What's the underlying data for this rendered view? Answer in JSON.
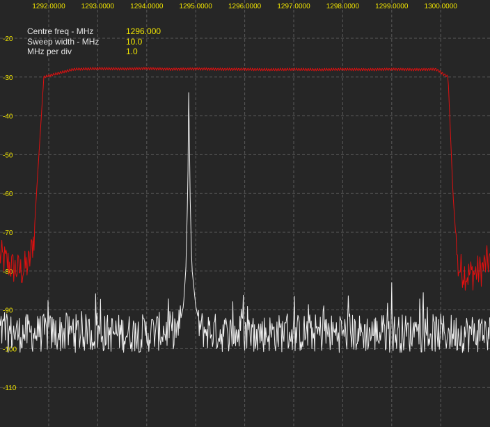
{
  "info": {
    "centre_label": "Centre freq - MHz",
    "centre_value": "1296.000",
    "sweep_label": "Sweep width - MHz",
    "sweep_value": "10.0",
    "mhz_div_label": "MHz per div",
    "mhz_div_value": "1.0"
  },
  "colors": {
    "background": "#262626",
    "grid": "#5a5a5a",
    "x_tick_text": "#f2e600",
    "y_tick_text": "#f2e600",
    "trace_red": "#e01010",
    "trace_white": "#f0f0f0"
  },
  "chart_data": {
    "type": "line",
    "title": "",
    "xlabel": "",
    "ylabel": "",
    "x_unit": "MHz",
    "y_unit": "dB",
    "grid": true,
    "xlim": [
      1291.0,
      1301.0
    ],
    "ylim": [
      -120,
      -18
    ],
    "x_ticks": [
      "1292.0000",
      "1293.0000",
      "1294.0000",
      "1295.0000",
      "1296.0000",
      "1297.0000",
      "1298.0000",
      "1299.0000",
      "1300.0000"
    ],
    "y_ticks": [
      "-20",
      "-30",
      "-40",
      "-50",
      "-60",
      "-70",
      "-80",
      "-90",
      "-100",
      "-110"
    ],
    "series": [
      {
        "color": "#e01010",
        "x": [
          1291.0,
          1291.25,
          1291.45,
          1291.6,
          1291.7,
          1291.75,
          1291.9,
          1292.5,
          1293.0,
          1293.5,
          1294.0,
          1294.5,
          1295.0,
          1295.5,
          1296.0,
          1296.5,
          1297.0,
          1297.5,
          1298.0,
          1298.5,
          1299.0,
          1299.5,
          1299.9,
          1300.15,
          1300.25,
          1300.35,
          1300.55,
          1300.8,
          1301.0
        ],
        "y": [
          -76,
          -79,
          -80,
          -78,
          -71,
          -60,
          -30,
          -28,
          -27.8,
          -27.9,
          -27.8,
          -28.0,
          -27.9,
          -28.0,
          -28.0,
          -28.1,
          -28.0,
          -28.1,
          -28.0,
          -28.1,
          -28.0,
          -28.1,
          -28.0,
          -30,
          -60,
          -79,
          -81,
          -80,
          -77
        ]
      },
      {
        "color": "#f0f0f0",
        "x": [
          1291.0,
          1292.0,
          1293.0,
          1294.0,
          1294.65,
          1294.75,
          1294.8,
          1294.84,
          1294.86,
          1294.88,
          1294.92,
          1295.0,
          1295.1,
          1295.5,
          1296.0,
          1297.0,
          1298.0,
          1298.99,
          1299.0,
          1299.01,
          1300.0,
          1301.0
        ],
        "y": [
          -96,
          -96,
          -96,
          -96,
          -95,
          -89,
          -79,
          -58,
          -30,
          -58,
          -79,
          -89,
          -95,
          -96,
          -96,
          -96,
          -96,
          -96,
          -83,
          -96,
          -96,
          -96
        ]
      }
    ]
  }
}
